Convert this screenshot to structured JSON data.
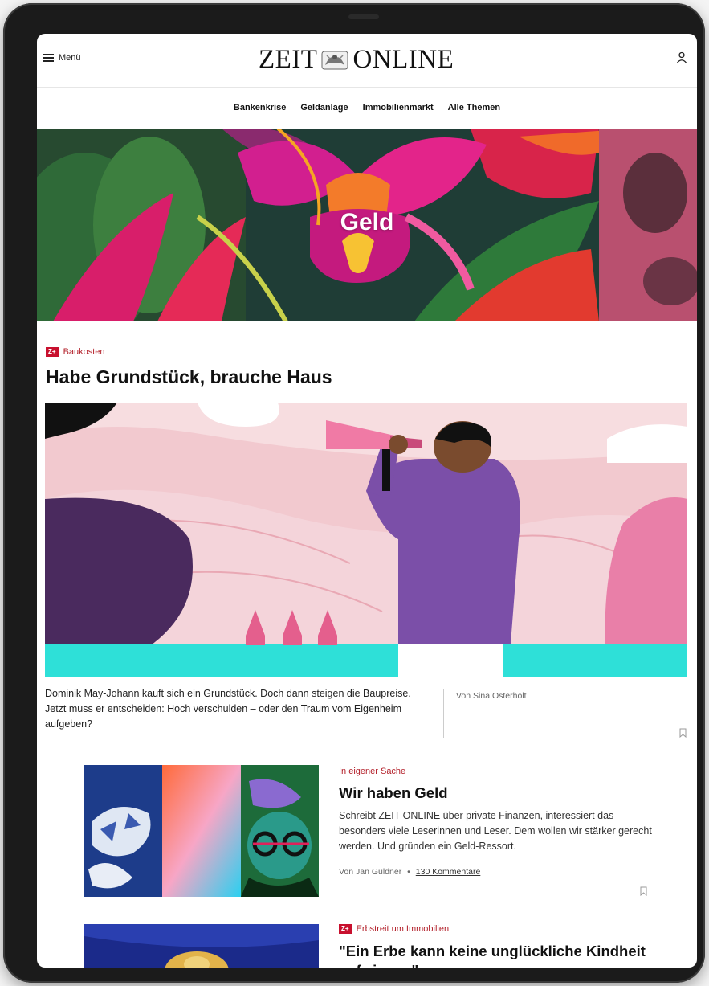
{
  "header": {
    "menu_label": "Menü",
    "logo_left": "ZEIT",
    "logo_right": "ONLINE",
    "nav": [
      "Bankenkrise",
      "Geldanlage",
      "Immobilienmarkt",
      "Alle Themen"
    ]
  },
  "hero": {
    "title": "Geld"
  },
  "lead": {
    "badge": "Z+",
    "kicker": "Baukosten",
    "title": "Habe Grundstück, brauche Haus",
    "teaser": "Dominik May-Johann kauft sich ein Grundstück. Doch dann steigen die Baupreise. Jetzt muss er entscheiden: Hoch verschulden – oder den Traum vom Eigenheim aufgeben?",
    "byline": "Von Sina Osterholt"
  },
  "articles": [
    {
      "kicker": "In eigener Sache",
      "title": "Wir haben Geld",
      "teaser": "Schreibt ZEIT ONLINE über private Finanzen, interessiert das besonders viele Leserinnen und Leser. Dem wollen wir stärker gerecht werden. Und gründen ein Geld-Ressort.",
      "byline": "Von Jan Guldner",
      "separator": "•",
      "comments": "130 Kommentare"
    },
    {
      "badge": "Z+",
      "kicker": "Erbstreit um Immobilien",
      "title": "\"Ein Erbe kann keine unglückliche Kindheit aufwiegen\""
    }
  ],
  "colors": {
    "accent": "#b3202a",
    "zplus": "#c8102e"
  }
}
